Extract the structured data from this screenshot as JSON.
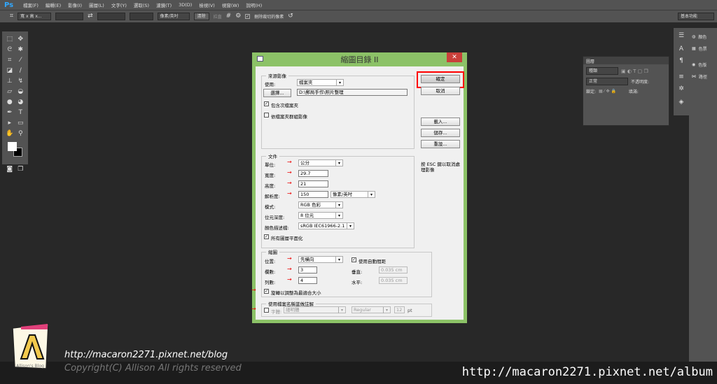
{
  "app": {
    "logo": "Ps",
    "menu": [
      "檔案(F)",
      "編輯(E)",
      "影像(I)",
      "圖層(L)",
      "文字(Y)",
      "選取(S)",
      "濾鏡(T)",
      "3D(D)",
      "檢視(V)",
      "視窗(W)",
      "說明(H)"
    ]
  },
  "options": {
    "ratio": "寬 x 高 x...",
    "unit": "像素/英吋",
    "clear": "清除",
    "straighten": "拉直",
    "delete_cropped": "刪除裁切的像素",
    "workspace": "基本功能"
  },
  "layers_panel": {
    "title": "圖層",
    "filter": "種類",
    "blend": "正常",
    "opacity_label": "不透明度:",
    "lock_label": "鎖定:",
    "fill_label": "填滿:"
  },
  "right_panels": [
    "顏色",
    "色票",
    "色版",
    "路徑"
  ],
  "dialog": {
    "title": "縮圖目錄 II",
    "source": {
      "legend": "來源影像",
      "use_label": "使用:",
      "use_value": "檔案夾",
      "choose": "選擇...",
      "path": "D:\\郵局手作\\照片整理",
      "include_sub": "包含次檔案夾",
      "group_by_folder": "依檔案夾群組影像",
      "include_sub_checked": true,
      "group_checked": false
    },
    "document": {
      "legend": "文件",
      "unit_label": "單位:",
      "unit": "公分",
      "width_label": "寬度:",
      "width": "29.7",
      "height_label": "高度:",
      "height": "21",
      "res_label": "解析度:",
      "res": "150",
      "res_unit": "像素/英吋",
      "mode_label": "模式:",
      "mode": "RGB 色彩",
      "depth_label": "位元深度:",
      "depth": "8 位元",
      "profile_label": "顏色描述檔:",
      "profile": "sRGB IEC61966-2.1",
      "flatten": "所有圖層平面化",
      "flatten_checked": true
    },
    "thumbs": {
      "legend": "縮圖",
      "place_label": "位置:",
      "place": "先橫向",
      "auto_spacing": "使用自動間距",
      "auto_checked": true,
      "cols_label": "欄數:",
      "cols": "3",
      "rows_label": "列數:",
      "rows": "4",
      "vert_label": "垂直:",
      "vert": "0.035 cm",
      "horiz_label": "水平:",
      "horiz": "0.035 cm",
      "rotate": "旋轉以調整為最適合大小",
      "rotate_checked": true
    },
    "caption": {
      "legend": "使用檔案名稱當做註解",
      "font_label": "字體:",
      "font": "細明體",
      "style": "Regular",
      "size": "12",
      "pt": "pt",
      "checked": false
    },
    "buttons": {
      "ok": "確定",
      "cancel": "取消",
      "load": "載入...",
      "save": "儲存...",
      "reset": "重設..."
    },
    "esc_hint": "按 ESC 鍵以取消處理影像",
    "highlight_color": "#ff0000"
  },
  "watermark": {
    "blog_url": "http://macaron2271.pixnet.net/blog",
    "copyright": "Copyright(C) Allison All rights reserved",
    "album_url": "http://macaron2271.pixnet.net/album",
    "logo_text": "Allison's Blog"
  }
}
